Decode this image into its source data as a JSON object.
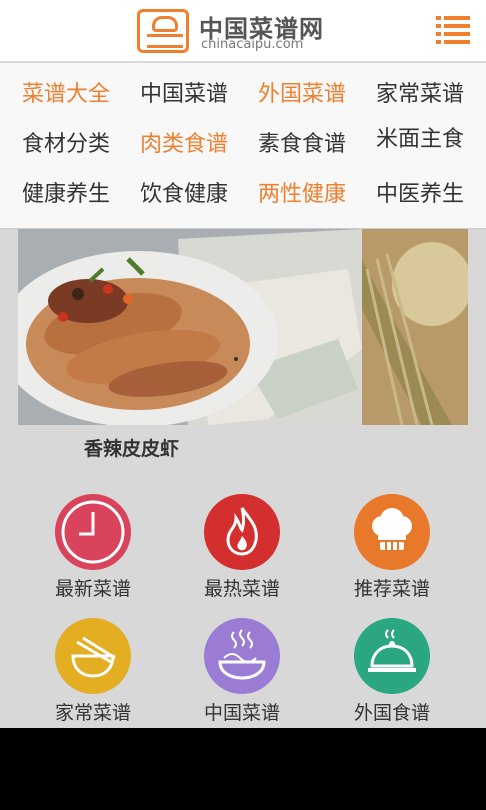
{
  "header": {
    "logo_title": "中国菜谱网",
    "logo_url": "chinacaipu.com"
  },
  "dropdown": {
    "rows": [
      [
        {
          "label": "菜谱大全",
          "active": true
        },
        {
          "label": "中国菜谱",
          "active": false
        },
        {
          "label": "外国菜谱",
          "active": true
        },
        {
          "label": "家常菜谱",
          "active": false
        }
      ],
      [
        {
          "label": "食材分类",
          "active": false
        },
        {
          "label": "肉类食谱",
          "active": true
        },
        {
          "label": "素食食谱",
          "active": false
        },
        {
          "label": "米面主食",
          "active": false
        }
      ],
      [
        {
          "label": "健康养生",
          "active": false
        },
        {
          "label": "饮食健康",
          "active": false
        },
        {
          "label": "两性健康",
          "active": true
        },
        {
          "label": "中医养生",
          "active": false
        }
      ]
    ]
  },
  "banner": {
    "caption": "香辣皮皮虾"
  },
  "categories": [
    {
      "label": "最新菜谱",
      "icon": "clock-icon",
      "color": "#d9435b"
    },
    {
      "label": "最热菜谱",
      "icon": "flame-icon",
      "color": "#d32f2f"
    },
    {
      "label": "推荐菜谱",
      "icon": "chef-hat-icon",
      "color": "#e8782a"
    },
    {
      "label": "家常菜谱",
      "icon": "bowl-chopsticks-icon",
      "color": "#e3ae22"
    },
    {
      "label": "中国菜谱",
      "icon": "noodles-icon",
      "color": "#9a7cd4"
    },
    {
      "label": "外国食谱",
      "icon": "cloche-icon",
      "color": "#2aa680"
    }
  ],
  "colors": {
    "accent": "#f07f2f",
    "text": "#333333"
  }
}
